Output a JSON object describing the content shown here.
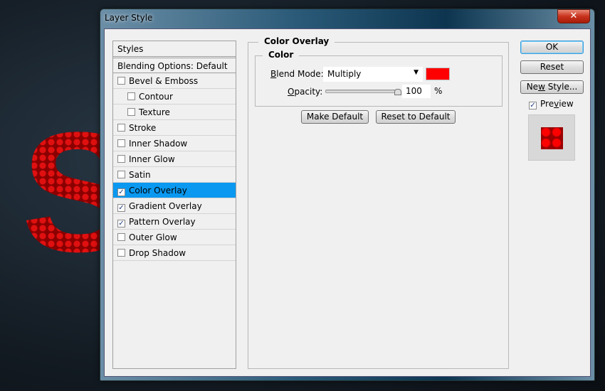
{
  "window": {
    "title": "Layer Style",
    "close": "✕"
  },
  "list": {
    "header": "Styles",
    "blending": "Blending Options: Default",
    "items": [
      {
        "label": "Bevel & Emboss",
        "checked": false,
        "sub": false
      },
      {
        "label": "Contour",
        "checked": false,
        "sub": true
      },
      {
        "label": "Texture",
        "checked": false,
        "sub": true
      },
      {
        "label": "Stroke",
        "checked": false,
        "sub": false
      },
      {
        "label": "Inner Shadow",
        "checked": false,
        "sub": false
      },
      {
        "label": "Inner Glow",
        "checked": false,
        "sub": false
      },
      {
        "label": "Satin",
        "checked": false,
        "sub": false
      },
      {
        "label": "Color Overlay",
        "checked": true,
        "sub": false,
        "selected": true
      },
      {
        "label": "Gradient Overlay",
        "checked": true,
        "sub": false
      },
      {
        "label": "Pattern Overlay",
        "checked": true,
        "sub": false
      },
      {
        "label": "Outer Glow",
        "checked": false,
        "sub": false
      },
      {
        "label": "Drop Shadow",
        "checked": false,
        "sub": false
      }
    ]
  },
  "panel": {
    "title": "Color Overlay",
    "group": "Color",
    "blend_label": "Blend Mode:",
    "blend_value": "Multiply",
    "color": "#ff0000",
    "opacity_label": "Opacity:",
    "opacity_value": "100",
    "opacity_unit": "%",
    "opacity_percent": 100,
    "make_default": "Make Default",
    "reset_default": "Reset to Default"
  },
  "buttons": {
    "ok": "OK",
    "reset": "Reset",
    "new_style": "New Style...",
    "preview": "Preview",
    "preview_checked": true
  }
}
